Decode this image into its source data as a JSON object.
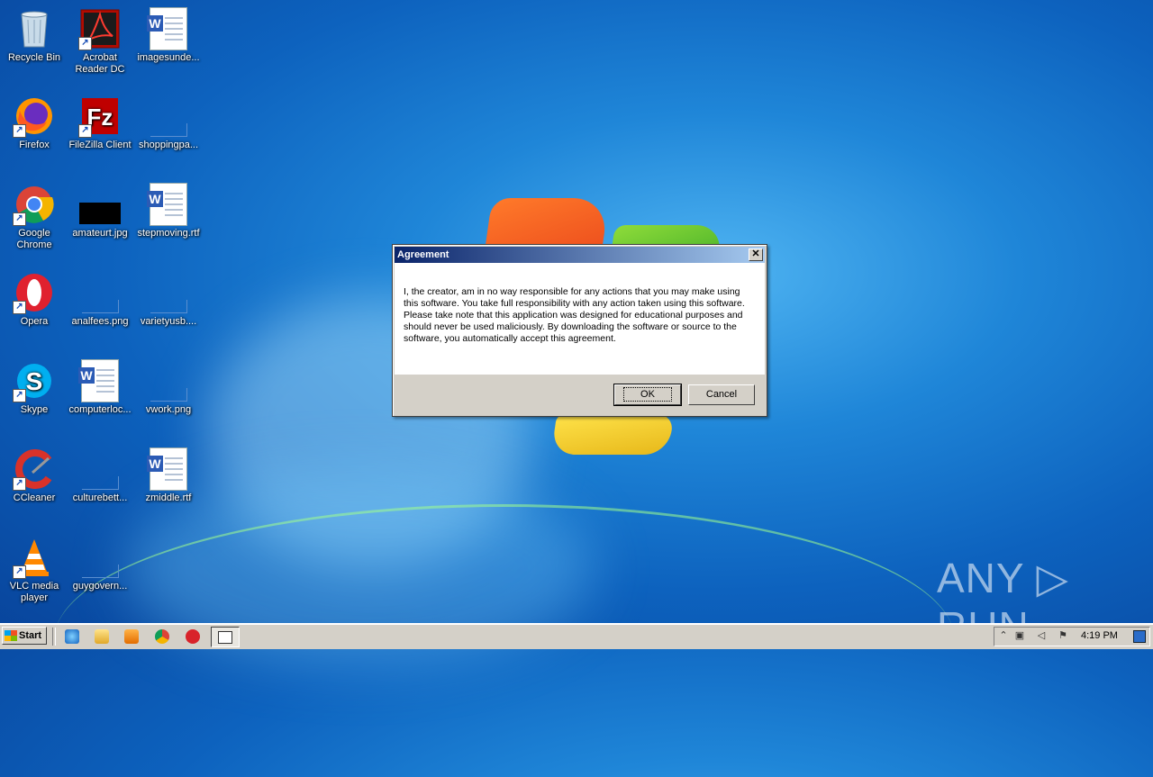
{
  "desktop": {
    "icons": [
      {
        "label": "Recycle Bin"
      },
      {
        "label": "Acrobat Reader DC"
      },
      {
        "label": "imagesunde..."
      },
      {
        "label": "Firefox"
      },
      {
        "label": "FileZilla Client"
      },
      {
        "label": "shoppingpa..."
      },
      {
        "label": "Google Chrome"
      },
      {
        "label": "amateurt.jpg"
      },
      {
        "label": "stepmoving.rtf"
      },
      {
        "label": "Opera"
      },
      {
        "label": "analfees.png"
      },
      {
        "label": "varietyusb...."
      },
      {
        "label": "Skype"
      },
      {
        "label": "computerloc..."
      },
      {
        "label": "vwork.png"
      },
      {
        "label": "CCleaner"
      },
      {
        "label": "culturebett..."
      },
      {
        "label": "zmiddle.rtf"
      },
      {
        "label": "VLC media player"
      },
      {
        "label": "guygovern..."
      }
    ]
  },
  "dialog": {
    "title": "Agreement",
    "close_glyph": "✕",
    "message": "I, the creator, am in no way responsible for any actions that you may make using this software. You take full responsibility with any action taken using this software. Please take note that this application was designed for educational purposes and should never be used maliciously. By downloading the software or source to the software, you automatically accept this agreement.",
    "ok_label": "OK",
    "cancel_label": "Cancel"
  },
  "taskbar": {
    "start_label": "Start",
    "clock": "4:19 PM"
  },
  "watermark": "ANY ▷ RUN",
  "colors": {
    "titlebar_start": "#0a246a",
    "titlebar_end": "#a6caf0",
    "dialog_face": "#d4d0c8"
  }
}
